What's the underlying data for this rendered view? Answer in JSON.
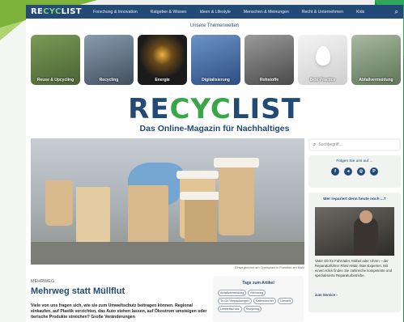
{
  "nav": {
    "logo_re": "RE",
    "logo_cyc": "CYC",
    "logo_list": "LIST",
    "items": [
      "Forschung & Innovation",
      "Ratgeber & Wissen",
      "Ideen & Lifestyle",
      "Menschen & Meinungen",
      "Recht & Unternehmen",
      "Kids"
    ],
    "search_icon": "search-icon"
  },
  "themen": {
    "title": "Unsere Themenwelten",
    "tiles": [
      "Reuse & Upcycling",
      "Recycling",
      "Energie",
      "Digitalisierung",
      "Rohstoffe",
      "Best Practice",
      "Abfallvermeidung"
    ]
  },
  "brand": {
    "logo_re": "RE",
    "logo_cyc": "CYC",
    "logo_list": "LIST",
    "tagline": "Das Online-Magazin für Nachhaltiges"
  },
  "article": {
    "caption": "Einwegbecher am Opernplatz in Frankfurt am Main",
    "rubric": "MEHRWEG",
    "headline": "Mehrweg statt Müllflut",
    "teaser": "Viele von uns fragen sich, wie sie zum Umweltschutz beitragen können. Regional einkaufen, auf Plastik verzichten, das Auto stehen lassen, auf Ökostrom umsteigen oder tierische Produkte streichen? Große Veränderungen"
  },
  "tags": {
    "title": "Tags zum Artikel",
    "items": [
      "Abfallvermeidung",
      "Mehrweg",
      "To-Go Verpackungen",
      "Kaffeebecher",
      "Umwelt",
      "Umweltschutz",
      "Recycling"
    ]
  },
  "sidebar": {
    "search_placeholder": "Suchbegriff...",
    "follow_title": "Folgen Sie uns auf ...",
    "socials": [
      "f",
      "◂",
      "◎",
      "P"
    ],
    "repair_title": "Wer repariert denn heute noch ...?",
    "repair_text": "Vater Ob für Fahrräder, Möbel oder Uhren – der Reparaturführer Rhein-Main listet Experten. Mit einem Klick finden Sie zahlreiche kompetente und spezialisierte Reparaturbetriebe.",
    "repair_link": "zum Service ›"
  },
  "colors": {
    "brand_blue": "#234a77",
    "brand_green": "#3aa64a"
  }
}
